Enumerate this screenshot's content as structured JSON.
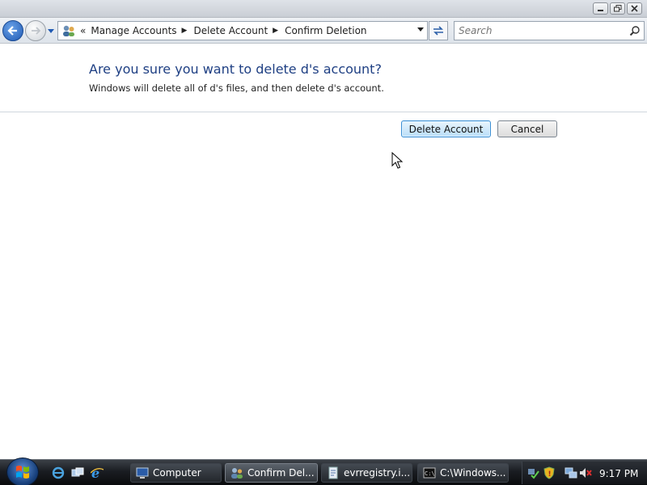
{
  "window": {
    "controls": {
      "minimize_icon": "minimize-icon",
      "maximize_icon": "restore-icon",
      "close_icon": "close-icon"
    }
  },
  "nav": {
    "back_icon": "back-arrow-icon",
    "forward_icon": "forward-arrow-icon",
    "breadcrumb_prefix": "«",
    "breadcrumbs": [
      "Manage Accounts",
      "Delete Account",
      "Confirm Deletion"
    ],
    "search_placeholder": "Search"
  },
  "dialog": {
    "heading": "Are you sure you want to delete d's account?",
    "description": "Windows will delete all of d's files, and then delete d's account.",
    "delete_label": "Delete Account",
    "cancel_label": "Cancel"
  },
  "taskbar": {
    "tasks": [
      {
        "label": "Computer",
        "icon": "computer-icon"
      },
      {
        "label": "Confirm Del...",
        "icon": "user-accounts-icon",
        "active": true
      },
      {
        "label": "evrregistry.i...",
        "icon": "document-icon"
      },
      {
        "label": "C:\\Windows...",
        "icon": "command-prompt-icon"
      }
    ],
    "clock": "9:17 PM"
  },
  "colors": {
    "heading": "#1e3f83",
    "accent": "#3c8fd3",
    "taskbar": "#1a1d22"
  }
}
